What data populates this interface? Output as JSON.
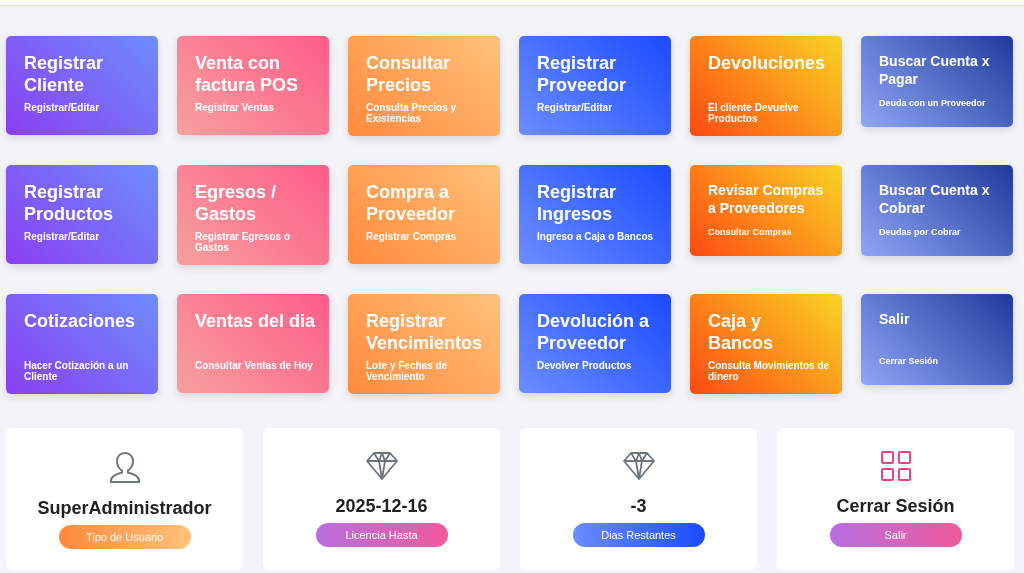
{
  "tile_rows": [
    [
      {
        "title": "Registrar Cliente",
        "subtitle": "Registrar/Editar",
        "kind": "standard"
      },
      {
        "title": "Venta con factura POS",
        "subtitle": "Registrar Ventas",
        "kind": "standard"
      },
      {
        "title": "Consultar Precios",
        "subtitle": "Consulta Precios y Existencias",
        "kind": "standard"
      },
      {
        "title": "Registrar Proveedor",
        "subtitle": "Registrar/Editar",
        "kind": "standard"
      },
      {
        "title": "Devoluciones",
        "subtitle": "El cliente Devuelve Productos",
        "kind": "standard"
      },
      {
        "title": "Buscar Cuenta x Pagar",
        "subtitle": "Deuda con un Proveedor",
        "kind": "compact"
      }
    ],
    [
      {
        "title": "Registrar Productos",
        "subtitle": "Registrar/Editar",
        "kind": "standard"
      },
      {
        "title": "Egresos / Gastos",
        "subtitle": "Registrar Egresos o Gastos",
        "kind": "standard"
      },
      {
        "title": "Compra a Proveedor",
        "subtitle": "Registrar Compras",
        "kind": "standard"
      },
      {
        "title": "Registrar Ingresos",
        "subtitle": "Ingreso a Caja o Bancos",
        "kind": "standard"
      },
      {
        "title": "Revisar Compras a Proveedores",
        "subtitle": "Consultar Compras",
        "kind": "compact"
      },
      {
        "title": "Buscar Cuenta x Cobrar",
        "subtitle": "Deudas por Cobrar",
        "kind": "compact"
      }
    ],
    [
      {
        "title": "Cotizaciones",
        "subtitle": "Hacer Cotización a un Cliente",
        "kind": "standard"
      },
      {
        "title": "Ventas del dia",
        "subtitle": "Consultar Ventas de Hoy",
        "kind": "standard"
      },
      {
        "title": "Registrar Vencimientos",
        "subtitle": "Lote y Fechas de Vencimiento",
        "kind": "standard"
      },
      {
        "title": "Devolución a Proveedor",
        "subtitle": "Devolver Productos",
        "kind": "standard"
      },
      {
        "title": "Caja y Bancos",
        "subtitle": "Consulta Movimientos de dinero",
        "kind": "standard"
      },
      {
        "title": "Salir",
        "subtitle": "Cerrar Sesión",
        "kind": "compact"
      }
    ]
  ],
  "info_cards": [
    {
      "kind": "user",
      "value": "SuperAdministrador",
      "badge": "Tipo de Usuario"
    },
    {
      "kind": "license",
      "value": "2025-12-16",
      "badge": "Licencia Hasta"
    },
    {
      "kind": "days",
      "value": "-3",
      "badge": "Dias Restantes"
    },
    {
      "kind": "logout",
      "value": "Cerrar Sesión",
      "badge": "Salir"
    }
  ]
}
